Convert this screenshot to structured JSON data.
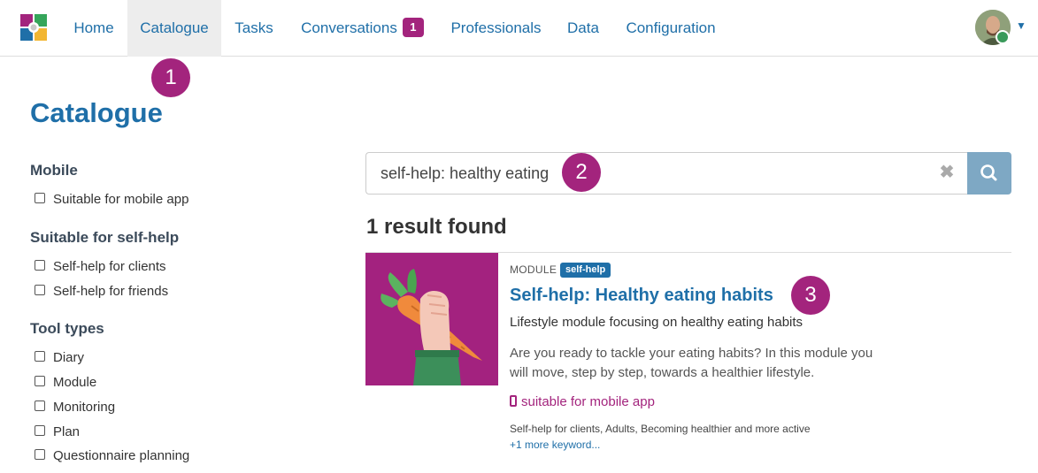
{
  "nav": {
    "items": [
      {
        "label": "Home"
      },
      {
        "label": "Catalogue"
      },
      {
        "label": "Tasks"
      },
      {
        "label": "Conversations",
        "badge": "1"
      },
      {
        "label": "Professionals"
      },
      {
        "label": "Data"
      },
      {
        "label": "Configuration"
      }
    ],
    "active": "Catalogue",
    "logo_icon": "app-logo-icon",
    "avatar_icon": "user-avatar",
    "caret_icon": "caret-down-icon"
  },
  "markers": [
    "1",
    "2",
    "3"
  ],
  "page": {
    "title": "Catalogue"
  },
  "filters": {
    "mobile": {
      "heading": "Mobile",
      "options": [
        "Suitable for mobile app"
      ]
    },
    "selfhelp": {
      "heading": "Suitable for self-help",
      "options": [
        "Self-help for clients",
        "Self-help for friends"
      ]
    },
    "tooltypes": {
      "heading": "Tool types",
      "options": [
        "Diary",
        "Module",
        "Monitoring",
        "Plan",
        "Questionnaire planning"
      ]
    }
  },
  "search": {
    "value": "self-help: healthy eating",
    "clear_icon": "clear-icon",
    "button_icon": "search-icon"
  },
  "results": {
    "count_text": "1 result found",
    "items": [
      {
        "type": "MODULE",
        "tag": "self-help",
        "title": "Self-help: Healthy eating habits",
        "subtitle": "Lifestyle module focusing on healthy eating habits",
        "description": "Are you ready to tackle your eating habits? In this module you will move, step by step, towards a healthier lifestyle.",
        "mobile": "suitable for mobile app",
        "keywords": "Self-help for clients, Adults, Becoming healthier and more active",
        "more": "+1 more keyword..."
      }
    ]
  },
  "colors": {
    "primary": "#1f6fa8",
    "accent": "#a3247d",
    "search_button": "#7ea8c4"
  }
}
